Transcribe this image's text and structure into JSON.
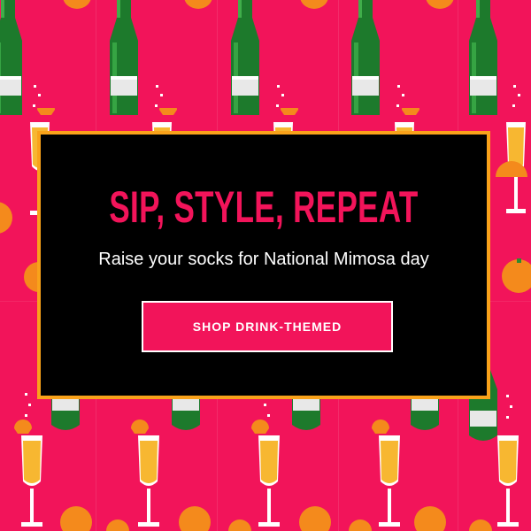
{
  "promo": {
    "headline": "SIP, STYLE, REPEAT",
    "subhead": "Raise your socks for National Mimosa day",
    "cta_label": "SHOP DRINK-THEMED"
  },
  "colors": {
    "background": "#f2145a",
    "card_background": "#000000",
    "card_border": "#f9a21a",
    "headline": "#f2145a",
    "subhead": "#ffffff",
    "button_background": "#f2145a",
    "button_border": "#ffffff",
    "button_text": "#ffffff"
  },
  "pattern": {
    "icons": [
      "champagne-bottle-icon",
      "mimosa-glass-icon",
      "orange-slice-icon",
      "whole-orange-icon",
      "sparkle-icon"
    ]
  }
}
